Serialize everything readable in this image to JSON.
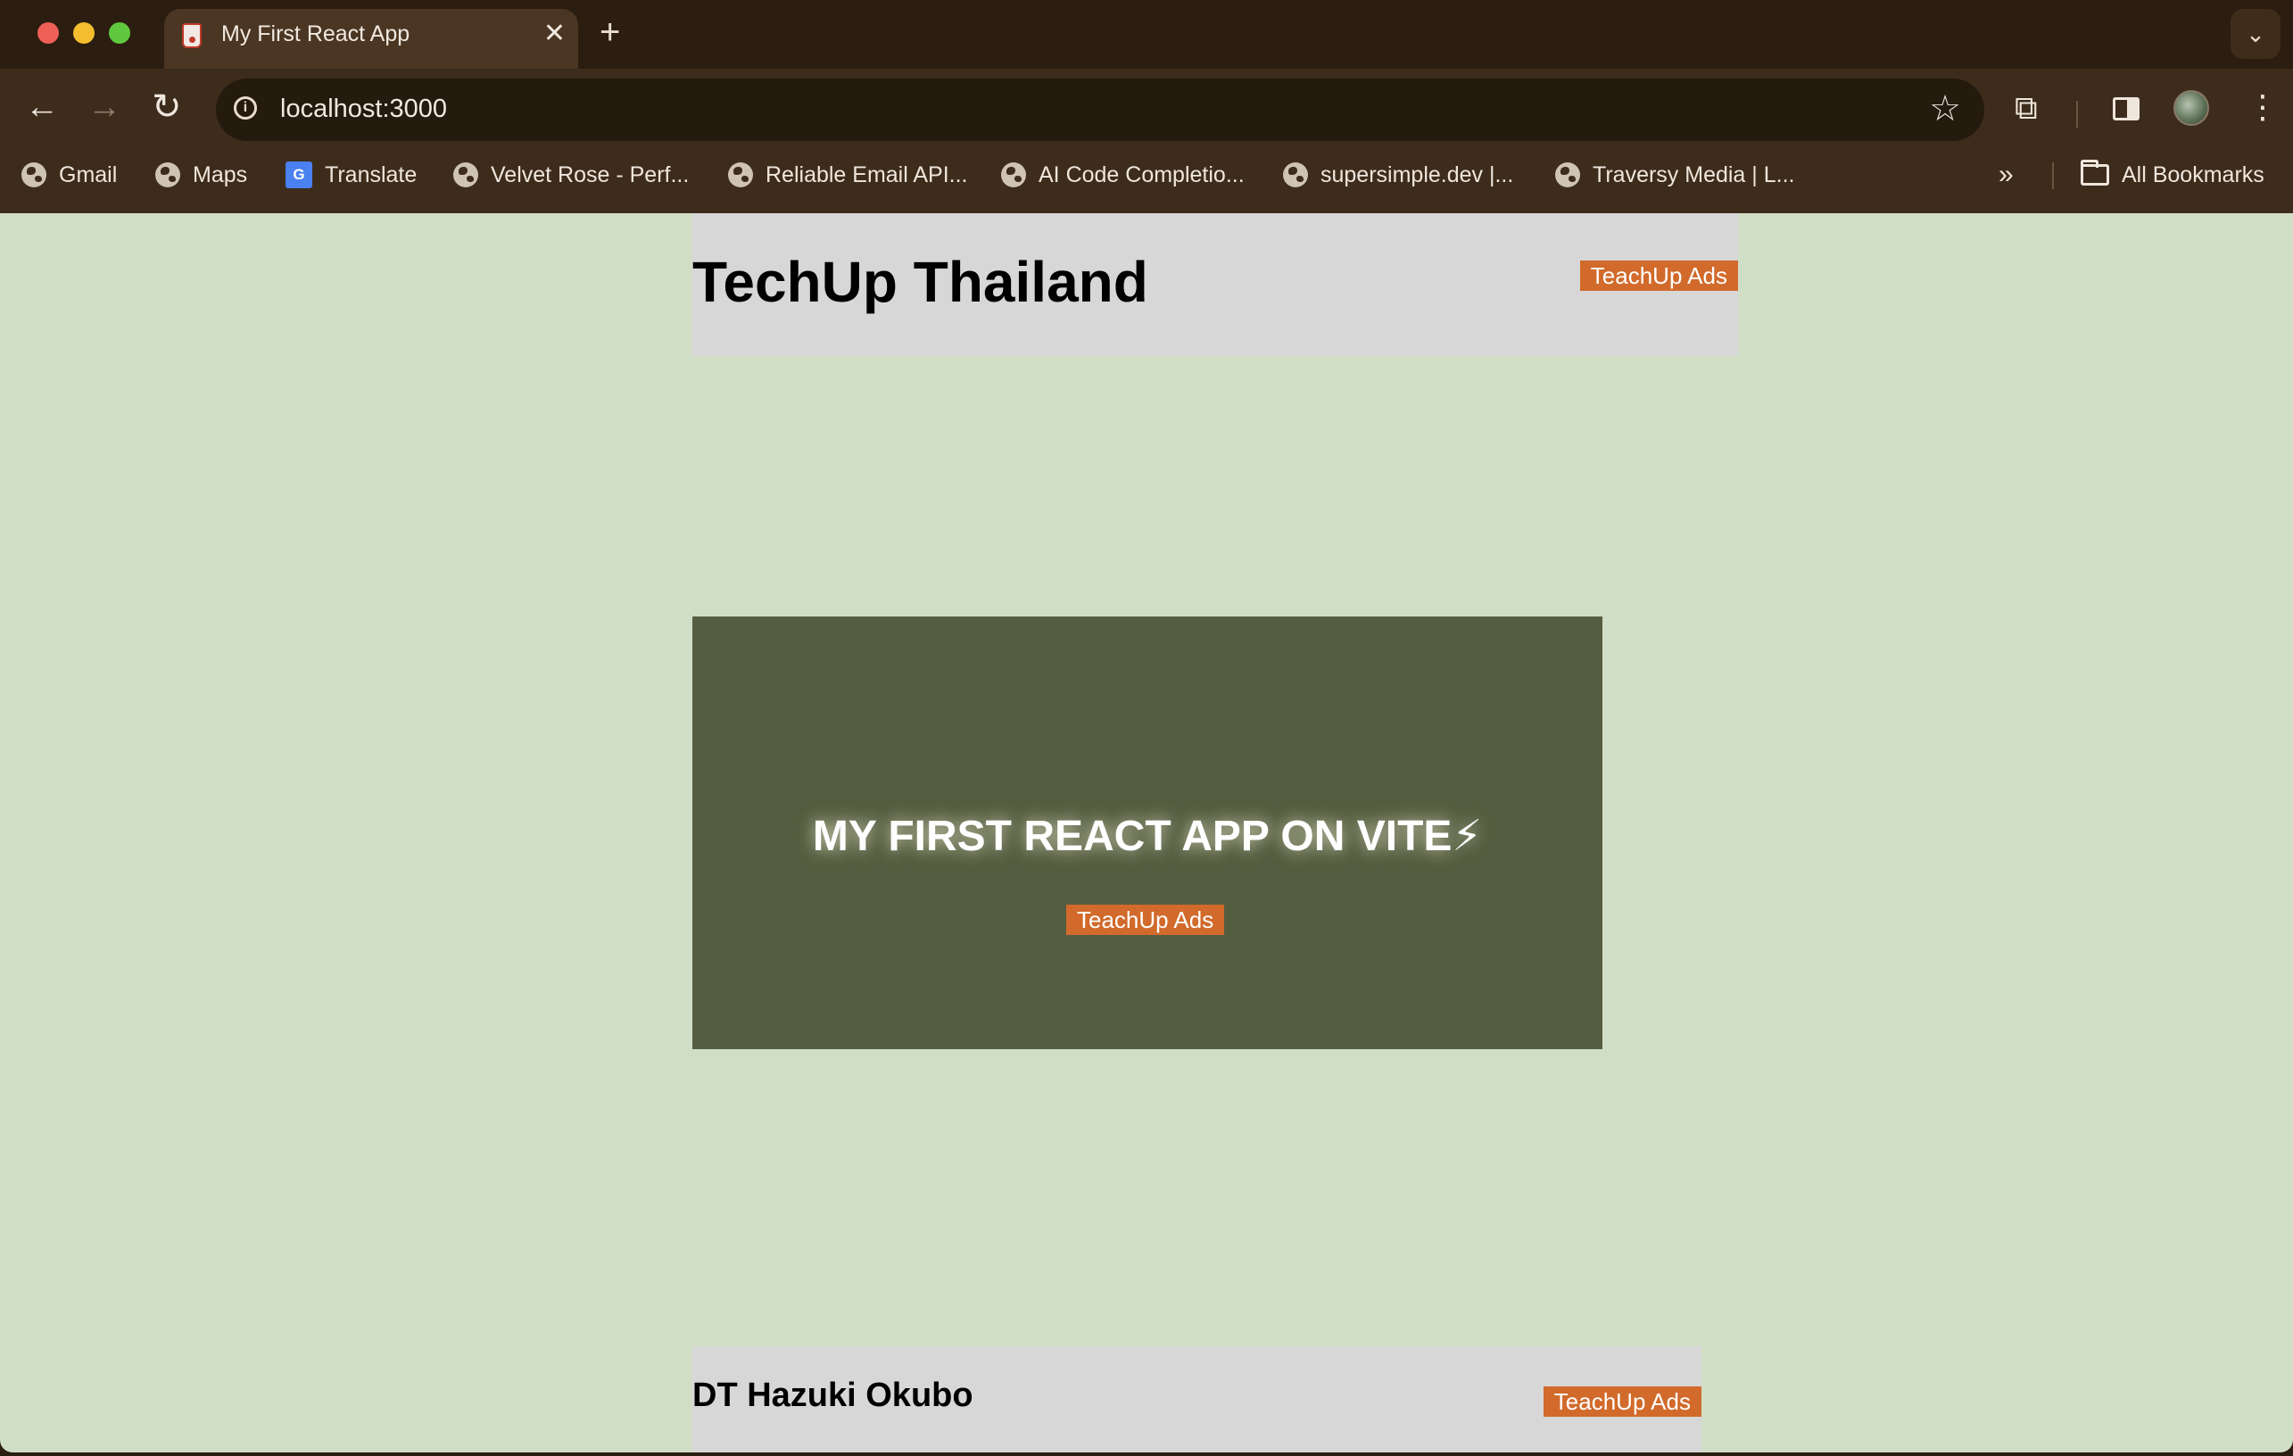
{
  "browser": {
    "tab": {
      "title": "My First React App",
      "close_glyph": "✕"
    },
    "new_tab_glyph": "+",
    "tab_menu_glyph": "⌄",
    "nav": {
      "back_glyph": "←",
      "forward_glyph": "→",
      "reload_glyph": "↻"
    },
    "url": "localhost:3000",
    "star_glyph": "☆",
    "extensions_glyph": "⧉",
    "menu_glyph": "⋮",
    "more_bookmarks_glyph": "»",
    "bookmarks": [
      {
        "label": "Gmail",
        "icon": "globe-icon"
      },
      {
        "label": "Maps",
        "icon": "globe-icon"
      },
      {
        "label": "Translate",
        "icon": "google-translate-icon"
      },
      {
        "label": "Velvet Rose - Perf...",
        "icon": "globe-icon"
      },
      {
        "label": "Reliable Email API...",
        "icon": "globe-icon"
      },
      {
        "label": "AI Code Completio...",
        "icon": "globe-icon"
      },
      {
        "label": "supersimple.dev |...",
        "icon": "globe-icon"
      },
      {
        "label": "Traversy Media | L...",
        "icon": "globe-icon"
      }
    ],
    "all_bookmarks": "All Bookmarks"
  },
  "page": {
    "header": {
      "title": "TechUp Thailand",
      "ads_button": "TeachUp Ads"
    },
    "hero": {
      "title": "MY FIRST REACT APP ON VITE⚡",
      "ads_button": "TeachUp Ads"
    },
    "footer": {
      "author": "DT Hazuki Okubo",
      "ads_button": "TeachUp Ads"
    }
  },
  "colors": {
    "page_background": "#d1dec6",
    "card_background": "#d7d7d7",
    "hero_background": "#555d40",
    "ads_button": "#d16a2b",
    "chrome_background": "#3d2c1c"
  }
}
